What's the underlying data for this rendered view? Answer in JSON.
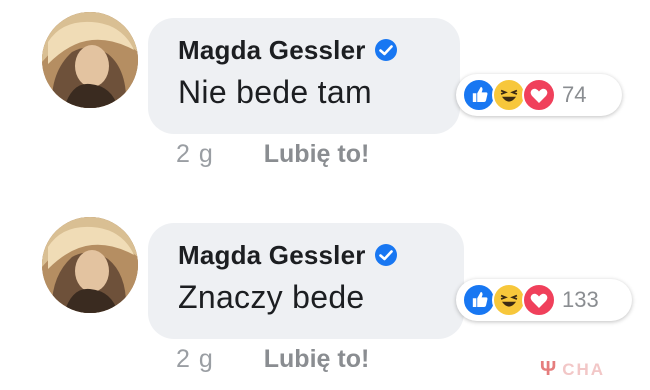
{
  "comments": [
    {
      "author": "Magda Gessler",
      "text": "Nie bede tam",
      "reaction_count": "74",
      "time": "2 g",
      "like_label": "Lubię to!"
    },
    {
      "author": "Magda Gessler",
      "text": "Znaczy bede",
      "reaction_count": "133",
      "time": "2 g",
      "like_label": "Lubię to!"
    }
  ],
  "reactions": [
    "like-icon",
    "haha-icon",
    "love-icon"
  ],
  "colors": {
    "like": "#1877f2",
    "haha": "#f7c73b",
    "love": "#f0405b",
    "verified": "#1877f2"
  },
  "watermark": {
    "text": "CHA",
    "icon": "fork-icon"
  }
}
